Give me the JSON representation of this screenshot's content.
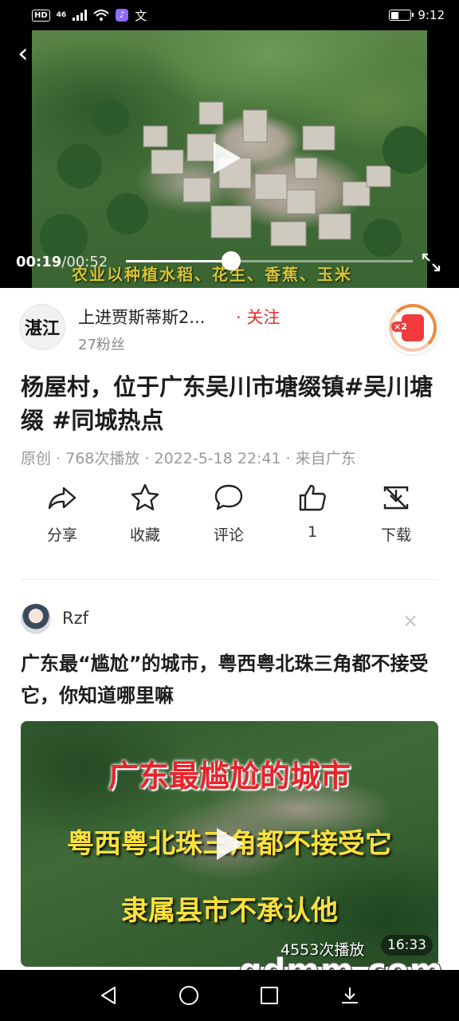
{
  "status_bar": {
    "hd": "HD",
    "network": "46",
    "time": "9:12"
  },
  "video": {
    "current_time": "00:19",
    "duration": "/00:52",
    "progress": 0.3654,
    "caption": "农业以种植水稻、花生、香蕉、玉米"
  },
  "author": {
    "avatar_text": "湛江",
    "name": "上进贾斯蒂斯2...",
    "follow_label": "关注",
    "fans": "27粉丝",
    "badge_text": "×2"
  },
  "post": {
    "title": "杨屋村，位于广东吴川市塘缀镇#吴川塘缀 #同城热点",
    "meta": "原创 · 768次播放 · 2022-5-18 22:41 · 来自广东"
  },
  "actions": [
    {
      "id": "share",
      "label": "分享"
    },
    {
      "id": "favorite",
      "label": "收藏"
    },
    {
      "id": "comment",
      "label": "评论"
    },
    {
      "id": "like",
      "label": "1"
    },
    {
      "id": "download",
      "label": "下载"
    }
  ],
  "recommended": {
    "user": "Rzf",
    "close": "×",
    "title": "广东最“尴尬”的城市，粤西粤北珠三角都不接受它，你知道哪里嘛",
    "thumb_line1": "广东最尴尬的城市",
    "thumb_line2": "粤西粤北珠三角都不接受它",
    "thumb_line3": "隶属县市不承认他",
    "views": "4553次播放",
    "duration": "16:33"
  },
  "watermark": "gdmm.com"
}
